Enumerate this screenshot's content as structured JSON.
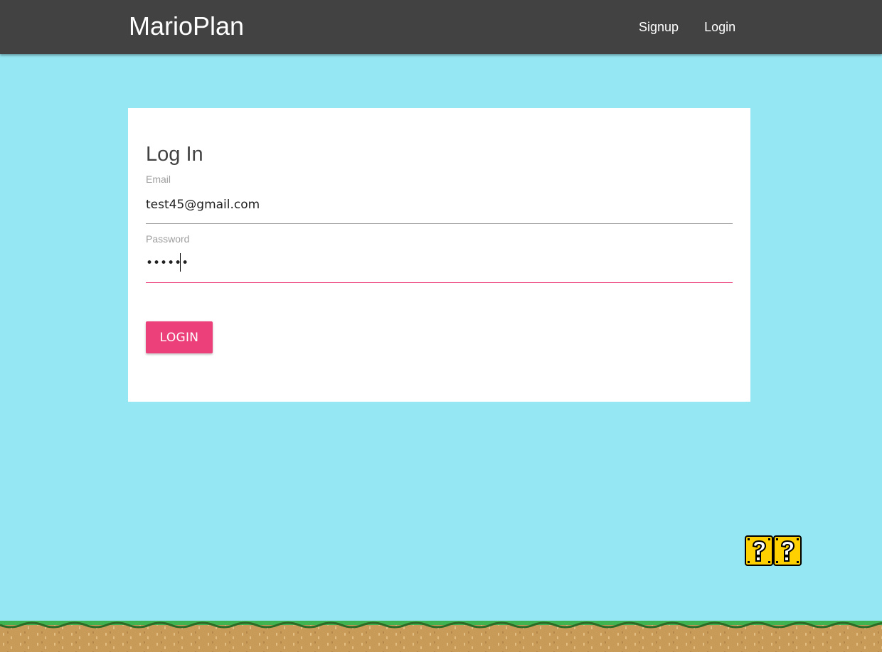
{
  "navbar": {
    "brand": "MarioPlan",
    "links": [
      {
        "label": "Signup"
      },
      {
        "label": "Login"
      }
    ]
  },
  "form": {
    "title": "Log In",
    "email": {
      "label": "Email",
      "value": "test45@gmail.com"
    },
    "password": {
      "label": "Password",
      "value": "••••••"
    },
    "submit_label": "LOGIN"
  },
  "decorations": {
    "question_blocks": [
      "question-block-icon",
      "question-block-icon"
    ],
    "ground": "grass-ground"
  },
  "colors": {
    "navbar": "#424242",
    "sky": "#95e7f3",
    "accent": "#ec407a",
    "card": "#ffffff"
  }
}
